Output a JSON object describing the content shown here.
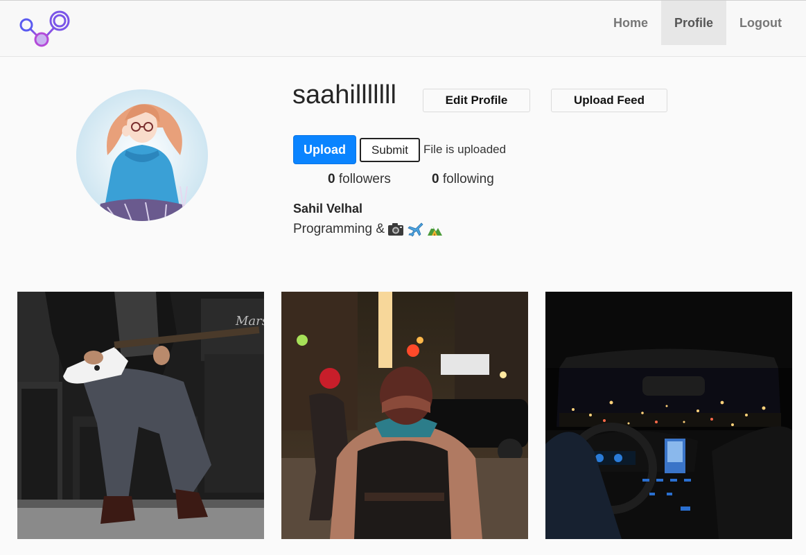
{
  "nav": {
    "home": "Home",
    "profile": "Profile",
    "logout": "Logout"
  },
  "profile": {
    "username": "saahilllllll",
    "edit_profile": "Edit Profile",
    "upload_feed": "Upload Feed",
    "upload": "Upload",
    "submit": "Submit",
    "upload_status": "File is uploaded",
    "followers_count": "0",
    "followers_label": "followers",
    "following_count": "0",
    "following_label": "following",
    "full_name": "Sahil Velhal",
    "bio_text": "Programming &",
    "bio_icons": [
      "camera-icon",
      "airplane-icon",
      "camping-icon"
    ]
  },
  "colors": {
    "primary": "#0a84ff",
    "nav_active": "#e7e7e7",
    "background": "#fafafa",
    "logo_gradient": [
      "#5b5bf0",
      "#b44ad8"
    ]
  },
  "posts": [
    {
      "icon": "guitar-photo"
    },
    {
      "icon": "street-photo"
    },
    {
      "icon": "car-night-photo"
    }
  ]
}
